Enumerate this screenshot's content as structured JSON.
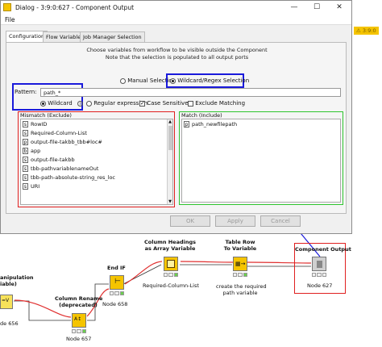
{
  "dialog": {
    "title": "Dialog - 3:9:0:627 - Component Output",
    "menu_file": "File",
    "tabs": [
      "Configuration",
      "Flow Variables",
      "Job Manager Selection"
    ],
    "intro_line1": "Choose variables from workflow to be visible outside the Component",
    "intro_line2": "Note that the selection is populated to all output ports",
    "manual_selection": "Manual Selection",
    "wildcard_regex_selection": "Wildcard/Regex Selection",
    "pattern_label": "Pattern:",
    "pattern_value": "path_*",
    "wildcard": "Wildcard",
    "regular_expression": "Regular expression",
    "case_sensitive": "Case Sensitive",
    "exclude_matching": "Exclude Matching",
    "mismatch_title": "Mismatch (Exclude)",
    "match_title": "Match (Include)",
    "mismatch_items": [
      {
        "type": "s",
        "label": "RowID"
      },
      {
        "type": "s",
        "label": "Required-Column-List"
      },
      {
        "type": "p",
        "label": "output-file-takbb_tbb#loc#"
      },
      {
        "type": "b",
        "label": "app"
      },
      {
        "type": "s",
        "label": "output-file-takbb"
      },
      {
        "type": "s",
        "label": "tbb-pathvariablenameOut"
      },
      {
        "type": "s",
        "label": "tbb-path-absolute-string_res_loc"
      },
      {
        "type": "s",
        "label": "URI"
      }
    ],
    "match_items": [
      {
        "type": "p",
        "label": "path_newfilepath"
      }
    ],
    "ok": "OK",
    "apply": "Apply",
    "cancel": "Cancel"
  },
  "workflow": {
    "warning": "3:9:0",
    "nodes": {
      "manipulation": {
        "title_line1": "anipulation",
        "title_line2": "iable)",
        "id": "de 656"
      },
      "column_rename": {
        "title_line1": "Column Rename",
        "title_line2": "(deprecated)",
        "id": "Node 657"
      },
      "end_if": {
        "title": "End IF",
        "id": "Node 658"
      },
      "column_headings": {
        "title_line1": "Column Headings",
        "title_line2": "as Array Variable",
        "id": "Required-Column-List"
      },
      "table_row": {
        "title_line1": "Table Row",
        "title_line2": "To Variable",
        "sub_line1": "create the required",
        "sub_line2": "path variable"
      },
      "component_output": {
        "title": "Component Output",
        "id": "Node 627"
      }
    }
  },
  "colors": {
    "highlight_blue": "#1a1adb",
    "mismatch_red": "#e02020",
    "match_green": "#2ec42e",
    "flow_variable_red": "#e03030",
    "node_yellow": "#f5c400"
  }
}
